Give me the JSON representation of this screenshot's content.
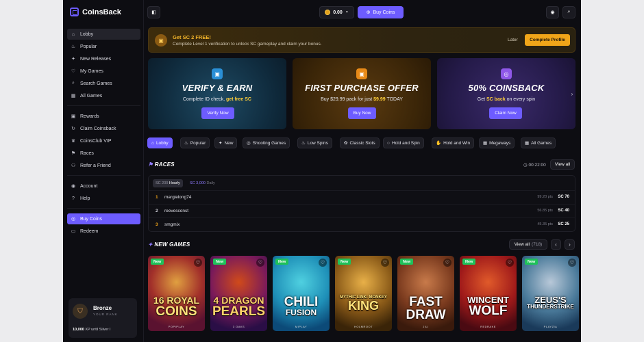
{
  "app": {
    "name": "CoinsBack"
  },
  "sidebar": {
    "group1": [
      {
        "label": "Lobby",
        "icon": "home-icon"
      },
      {
        "label": "Popular",
        "icon": "flame-icon"
      },
      {
        "label": "New Releases",
        "icon": "sparkle-icon"
      },
      {
        "label": "My Games",
        "icon": "heart-icon"
      },
      {
        "label": "Search Games",
        "icon": "search-icon"
      },
      {
        "label": "All Games",
        "icon": "grid-icon"
      }
    ],
    "group2": [
      {
        "label": "Rewards",
        "icon": "gift-icon"
      },
      {
        "label": "Claim Coinsback",
        "icon": "refresh-icon"
      },
      {
        "label": "CoinsClub VIP",
        "icon": "crown-icon"
      },
      {
        "label": "Races",
        "icon": "flag-icon"
      },
      {
        "label": "Refer a Friend",
        "icon": "user-plus-icon"
      }
    ],
    "group3": [
      {
        "label": "Account",
        "icon": "user-icon"
      },
      {
        "label": "Help",
        "icon": "help-icon"
      }
    ],
    "group4": [
      {
        "label": "Buy Coins",
        "icon": "coins-icon"
      },
      {
        "label": "Redeem",
        "icon": "wallet-icon"
      }
    ],
    "rank": {
      "name": "Bronze",
      "sub": "YOUR RANK",
      "xp_value": "10,000",
      "xp_text": " XP until Silver I"
    }
  },
  "topbar": {
    "balance": "0.00",
    "buy_label": "Buy Coins"
  },
  "banner": {
    "title": "Get SC 2 FREE!",
    "desc": "Complete Level 1 verification to unlock SC gameplay and claim your bonus.",
    "later": "Later",
    "cta": "Complete Profile"
  },
  "promos": [
    {
      "title": "VERIFY & EARN",
      "desc_a": "Complete ID check, ",
      "desc_b": "get free SC",
      "desc_c": "",
      "button": "Verify Now"
    },
    {
      "title": "FIRST PURCHASE OFFER",
      "desc_a": "Buy $29.99 pack for just ",
      "desc_b": "$9.99",
      "desc_c": " TODAY",
      "button": "Buy Now"
    },
    {
      "title": "50% COINSBACK",
      "desc_a": "Get ",
      "desc_b": "SC back",
      "desc_c": " on every spin",
      "button": "Claim Now"
    }
  ],
  "categories": [
    "Lobby",
    "Popular",
    "New",
    "Shooting Games",
    "Low Spins",
    "Classic Slots",
    "Hold and Spin",
    "Hold and Win",
    "Megaways",
    "All Games"
  ],
  "races": {
    "title": "RACES",
    "timer": "00:22:00",
    "view_all": "View all",
    "tabs": [
      {
        "amount": "SC 200",
        "period": "Hourly"
      },
      {
        "amount": "SC 3,000",
        "period": "Daily"
      }
    ],
    "rows": [
      {
        "rank": "1",
        "name": "margielong74",
        "points": "99.20 pts",
        "prize": "SC 70"
      },
      {
        "rank": "2",
        "name": "reevesconst",
        "points": "56.85 pts",
        "prize": "SC 40"
      },
      {
        "rank": "3",
        "name": "smgmix",
        "points": "45.35 pts",
        "prize": "SC 25"
      }
    ]
  },
  "new_games": {
    "title": "NEW GAMES",
    "view_all": "View all",
    "count": "(718)",
    "badge": "New",
    "items": [
      {
        "l1": "16 ROYAL",
        "l2": "COINS",
        "provider": "POPIPLAY"
      },
      {
        "l1": "4 DRAGON",
        "l2": "PEARLS",
        "provider": "3 OAKS"
      },
      {
        "l1": "CHILI",
        "l2": "FUSION",
        "provider": "MIPLAY"
      },
      {
        "l1": "MYTHIC LINK: MONKEY",
        "l2": "KING",
        "provider": "HOLMROOT"
      },
      {
        "l1": "FAST",
        "l2": "DRAW",
        "provider": "JILI"
      },
      {
        "l1": "WINCENT",
        "l2": "WOLF",
        "provider": "REDRAKE"
      },
      {
        "l1": "ZEUS'S",
        "l2": "THUNDERSTRIKE",
        "provider": "PLAYZIA"
      }
    ]
  }
}
